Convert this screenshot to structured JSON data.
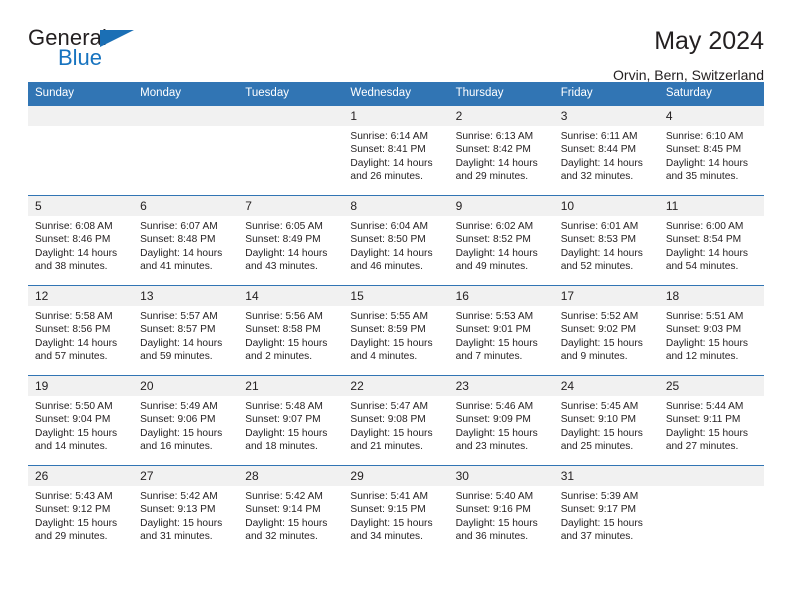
{
  "logo": {
    "name_top": "General",
    "name_bottom": "Blue",
    "triangle_icon": "triangle-icon",
    "accent_color": "#1b6fb5"
  },
  "header": {
    "title": "May 2024",
    "subtitle": "Orvin, Bern, Switzerland"
  },
  "colors": {
    "header_blue": "#3175b4",
    "daynum_gray": "#f1f1f1",
    "text": "#231f20"
  },
  "weekdays": [
    "Sunday",
    "Monday",
    "Tuesday",
    "Wednesday",
    "Thursday",
    "Friday",
    "Saturday"
  ],
  "labels": {
    "sunrise": "Sunrise:",
    "sunset": "Sunset:",
    "daylight": "Daylight:"
  },
  "weeks": [
    [
      {
        "day": "",
        "empty": true
      },
      {
        "day": "",
        "empty": true
      },
      {
        "day": "",
        "empty": true
      },
      {
        "day": "1",
        "sunrise": "Sunrise: 6:14 AM",
        "sunset": "Sunset: 8:41 PM",
        "daylight1": "Daylight: 14 hours",
        "daylight2": "and 26 minutes."
      },
      {
        "day": "2",
        "sunrise": "Sunrise: 6:13 AM",
        "sunset": "Sunset: 8:42 PM",
        "daylight1": "Daylight: 14 hours",
        "daylight2": "and 29 minutes."
      },
      {
        "day": "3",
        "sunrise": "Sunrise: 6:11 AM",
        "sunset": "Sunset: 8:44 PM",
        "daylight1": "Daylight: 14 hours",
        "daylight2": "and 32 minutes."
      },
      {
        "day": "4",
        "sunrise": "Sunrise: 6:10 AM",
        "sunset": "Sunset: 8:45 PM",
        "daylight1": "Daylight: 14 hours",
        "daylight2": "and 35 minutes."
      }
    ],
    [
      {
        "day": "5",
        "sunrise": "Sunrise: 6:08 AM",
        "sunset": "Sunset: 8:46 PM",
        "daylight1": "Daylight: 14 hours",
        "daylight2": "and 38 minutes."
      },
      {
        "day": "6",
        "sunrise": "Sunrise: 6:07 AM",
        "sunset": "Sunset: 8:48 PM",
        "daylight1": "Daylight: 14 hours",
        "daylight2": "and 41 minutes."
      },
      {
        "day": "7",
        "sunrise": "Sunrise: 6:05 AM",
        "sunset": "Sunset: 8:49 PM",
        "daylight1": "Daylight: 14 hours",
        "daylight2": "and 43 minutes."
      },
      {
        "day": "8",
        "sunrise": "Sunrise: 6:04 AM",
        "sunset": "Sunset: 8:50 PM",
        "daylight1": "Daylight: 14 hours",
        "daylight2": "and 46 minutes."
      },
      {
        "day": "9",
        "sunrise": "Sunrise: 6:02 AM",
        "sunset": "Sunset: 8:52 PM",
        "daylight1": "Daylight: 14 hours",
        "daylight2": "and 49 minutes."
      },
      {
        "day": "10",
        "sunrise": "Sunrise: 6:01 AM",
        "sunset": "Sunset: 8:53 PM",
        "daylight1": "Daylight: 14 hours",
        "daylight2": "and 52 minutes."
      },
      {
        "day": "11",
        "sunrise": "Sunrise: 6:00 AM",
        "sunset": "Sunset: 8:54 PM",
        "daylight1": "Daylight: 14 hours",
        "daylight2": "and 54 minutes."
      }
    ],
    [
      {
        "day": "12",
        "sunrise": "Sunrise: 5:58 AM",
        "sunset": "Sunset: 8:56 PM",
        "daylight1": "Daylight: 14 hours",
        "daylight2": "and 57 minutes."
      },
      {
        "day": "13",
        "sunrise": "Sunrise: 5:57 AM",
        "sunset": "Sunset: 8:57 PM",
        "daylight1": "Daylight: 14 hours",
        "daylight2": "and 59 minutes."
      },
      {
        "day": "14",
        "sunrise": "Sunrise: 5:56 AM",
        "sunset": "Sunset: 8:58 PM",
        "daylight1": "Daylight: 15 hours",
        "daylight2": "and 2 minutes."
      },
      {
        "day": "15",
        "sunrise": "Sunrise: 5:55 AM",
        "sunset": "Sunset: 8:59 PM",
        "daylight1": "Daylight: 15 hours",
        "daylight2": "and 4 minutes."
      },
      {
        "day": "16",
        "sunrise": "Sunrise: 5:53 AM",
        "sunset": "Sunset: 9:01 PM",
        "daylight1": "Daylight: 15 hours",
        "daylight2": "and 7 minutes."
      },
      {
        "day": "17",
        "sunrise": "Sunrise: 5:52 AM",
        "sunset": "Sunset: 9:02 PM",
        "daylight1": "Daylight: 15 hours",
        "daylight2": "and 9 minutes."
      },
      {
        "day": "18",
        "sunrise": "Sunrise: 5:51 AM",
        "sunset": "Sunset: 9:03 PM",
        "daylight1": "Daylight: 15 hours",
        "daylight2": "and 12 minutes."
      }
    ],
    [
      {
        "day": "19",
        "sunrise": "Sunrise: 5:50 AM",
        "sunset": "Sunset: 9:04 PM",
        "daylight1": "Daylight: 15 hours",
        "daylight2": "and 14 minutes."
      },
      {
        "day": "20",
        "sunrise": "Sunrise: 5:49 AM",
        "sunset": "Sunset: 9:06 PM",
        "daylight1": "Daylight: 15 hours",
        "daylight2": "and 16 minutes."
      },
      {
        "day": "21",
        "sunrise": "Sunrise: 5:48 AM",
        "sunset": "Sunset: 9:07 PM",
        "daylight1": "Daylight: 15 hours",
        "daylight2": "and 18 minutes."
      },
      {
        "day": "22",
        "sunrise": "Sunrise: 5:47 AM",
        "sunset": "Sunset: 9:08 PM",
        "daylight1": "Daylight: 15 hours",
        "daylight2": "and 21 minutes."
      },
      {
        "day": "23",
        "sunrise": "Sunrise: 5:46 AM",
        "sunset": "Sunset: 9:09 PM",
        "daylight1": "Daylight: 15 hours",
        "daylight2": "and 23 minutes."
      },
      {
        "day": "24",
        "sunrise": "Sunrise: 5:45 AM",
        "sunset": "Sunset: 9:10 PM",
        "daylight1": "Daylight: 15 hours",
        "daylight2": "and 25 minutes."
      },
      {
        "day": "25",
        "sunrise": "Sunrise: 5:44 AM",
        "sunset": "Sunset: 9:11 PM",
        "daylight1": "Daylight: 15 hours",
        "daylight2": "and 27 minutes."
      }
    ],
    [
      {
        "day": "26",
        "sunrise": "Sunrise: 5:43 AM",
        "sunset": "Sunset: 9:12 PM",
        "daylight1": "Daylight: 15 hours",
        "daylight2": "and 29 minutes."
      },
      {
        "day": "27",
        "sunrise": "Sunrise: 5:42 AM",
        "sunset": "Sunset: 9:13 PM",
        "daylight1": "Daylight: 15 hours",
        "daylight2": "and 31 minutes."
      },
      {
        "day": "28",
        "sunrise": "Sunrise: 5:42 AM",
        "sunset": "Sunset: 9:14 PM",
        "daylight1": "Daylight: 15 hours",
        "daylight2": "and 32 minutes."
      },
      {
        "day": "29",
        "sunrise": "Sunrise: 5:41 AM",
        "sunset": "Sunset: 9:15 PM",
        "daylight1": "Daylight: 15 hours",
        "daylight2": "and 34 minutes."
      },
      {
        "day": "30",
        "sunrise": "Sunrise: 5:40 AM",
        "sunset": "Sunset: 9:16 PM",
        "daylight1": "Daylight: 15 hours",
        "daylight2": "and 36 minutes."
      },
      {
        "day": "31",
        "sunrise": "Sunrise: 5:39 AM",
        "sunset": "Sunset: 9:17 PM",
        "daylight1": "Daylight: 15 hours",
        "daylight2": "and 37 minutes."
      },
      {
        "day": "",
        "empty": true
      }
    ]
  ]
}
